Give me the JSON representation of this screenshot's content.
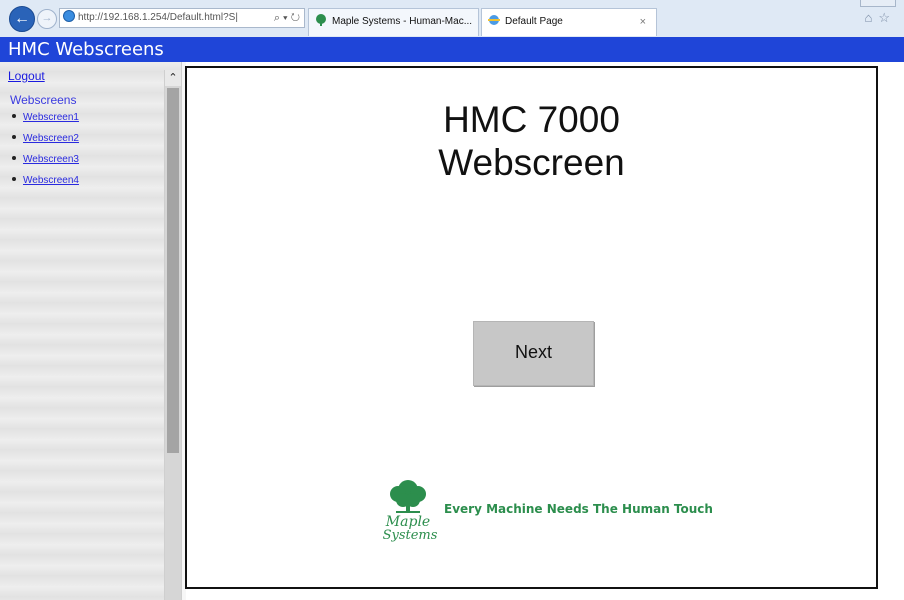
{
  "browser": {
    "address_url": "http://192.168.1.254/Default.html?S|",
    "address_controls": "⌕ ▾ ↻",
    "tabs": [
      {
        "label": "Maple Systems - Human-Mac..."
      },
      {
        "label": "Default Page",
        "close": "×"
      }
    ],
    "home_icon": "home-icon",
    "favorites_icon": "star-icon"
  },
  "titlebar": {
    "title": "HMC Webscreens"
  },
  "sidebar": {
    "logout_label": "Logout",
    "section_title": "Webscreens",
    "items": [
      {
        "label": "Webscreen1"
      },
      {
        "label": "Webscreen2"
      },
      {
        "label": "Webscreen3"
      },
      {
        "label": "Webscreen4"
      }
    ]
  },
  "main": {
    "heading_line1": "HMC 7000",
    "heading_line2": "Webscreen",
    "next_label": "Next",
    "logo": {
      "brand_line1": "Maple",
      "brand_line2": "Systems",
      "tagline": "Every Machine Needs The Human Touch"
    }
  },
  "colors": {
    "title_bar": "#1f45d8",
    "link": "#1a1adf",
    "button": "#c7c7c7",
    "logo_green": "#2c8e4d"
  }
}
